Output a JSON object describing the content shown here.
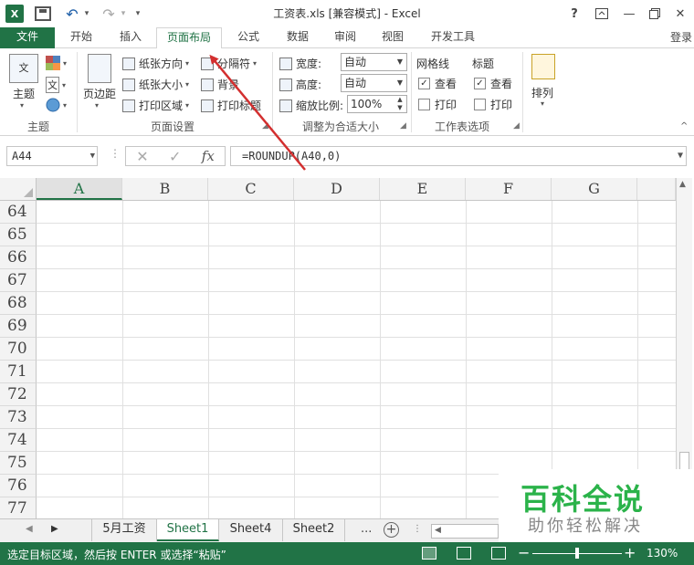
{
  "titlebar": {
    "title": "工资表.xls  [兼容模式] - Excel",
    "logo": "X",
    "help": "?",
    "icons": [
      "excel-logo-icon",
      "save-icon",
      "undo-icon",
      "redo-icon",
      "ribbon-display-icon",
      "minimize-icon",
      "maximize-icon",
      "close-icon"
    ]
  },
  "tabs": {
    "file": "文件",
    "items": [
      "开始",
      "插入",
      "页面布局",
      "公式",
      "数据",
      "审阅",
      "视图",
      "开发工具"
    ],
    "active": "页面布局",
    "login": "登录"
  },
  "ribbon": {
    "theme_group": {
      "label": "主题",
      "theme_btn": "主题",
      "colors_glyph": "",
      "fonts_glyph": "文",
      "effects_glyph": ""
    },
    "page_setup": {
      "label": "页面设置",
      "margins": "页边距",
      "orientation": "纸张方向",
      "size": "纸张大小",
      "print_area": "打印区域",
      "breaks": "分隔符",
      "background": "背景",
      "print_titles": "打印标题"
    },
    "scale_fit": {
      "label": "调整为合适大小",
      "width_label": "宽度:",
      "width_value": "自动",
      "height_label": "高度:",
      "height_value": "自动",
      "scale_label": "缩放比例:",
      "scale_value": "100%"
    },
    "sheet_options": {
      "label": "工作表选项",
      "gridlines": "网格线",
      "headings": "标题",
      "view": "查看",
      "print": "打印"
    },
    "arrange": {
      "label": "排列"
    }
  },
  "formula_bar": {
    "name_box": "A44",
    "formula": "=ROUNDUP(A40,0)",
    "fx": "fx"
  },
  "grid": {
    "columns": [
      "A",
      "B",
      "C",
      "D",
      "E",
      "F",
      "G"
    ],
    "selected_column": "A",
    "rows": [
      "64",
      "65",
      "66",
      "67",
      "68",
      "69",
      "70",
      "71",
      "72",
      "73",
      "74",
      "75",
      "76",
      "77"
    ]
  },
  "sheets": {
    "tabs": [
      "5月工资",
      "Sheet1",
      "Sheet4",
      "Sheet2"
    ],
    "active": "Sheet1",
    "more": "...",
    "add": "+"
  },
  "watermark": {
    "title": "百科全说",
    "subtitle": "助你轻松解决"
  },
  "statusbar": {
    "message": "选定目标区域，然后按 ENTER 或选择“粘贴”",
    "zoom": "130%",
    "zoom_fraction": 0.5
  },
  "colors": {
    "accent": "#217346",
    "annotation_arrow": "#d32f2f",
    "watermark": "#2bb34a"
  }
}
